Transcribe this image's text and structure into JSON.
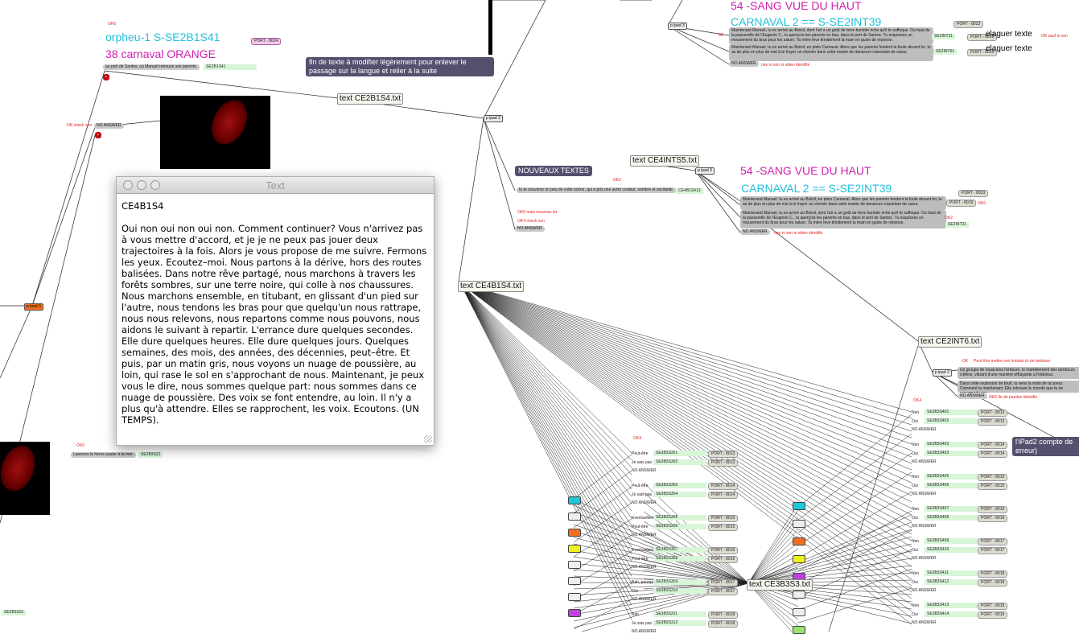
{
  "headings": {
    "orpheu": "orpheu-1  S-SE2B1S41",
    "carnaval_orange": "38 carnaval ORANGE",
    "sang1": "54 -SANG VUE DU HAUT",
    "carnaval2a": "CARNAVAL 2 == S-SE2INT39",
    "sang2": "54 -SANG VUE DU HAUT",
    "carnaval2b": "CARNAVAL 2 == S-SE2INT39"
  },
  "notes": {
    "fin_texte": "fin de texte à modifier légèrement pour enlever le passage sur la langue et relier à la suite",
    "nouveaux": "NOUVEAUX TEXTES",
    "ipad2_compte": "l'iPad2 compte de erreur)",
    "elaguer1": "elaguer texte",
    "elaguer2": "elaguer texte"
  },
  "objects": {
    "ce2b1s4": "text CE2B1S4.txt",
    "ce4ints5": "text CE4INTS5.txt",
    "ce4b1s4": "text CE4B1S4.txt",
    "ce2int6": "text CE2INT6.txt",
    "ce3b3s3": "text CE3B3S3.txt"
  },
  "window": {
    "title": "Text",
    "heading": "CE4B1S4",
    "body": "Oui non oui non oui non. Comment continuer? Vous n'arrivez pas à vous mettre d'accord, et je je ne peux pas jouer deux trajectoires à la fois. Alors je vous propose de me suivre. Fermons les yeux. Ecoutez–moi. Nous partons à la dérive, hors des routes balisées. Dans notre rêve partagé, nous marchons à travers les forêts sombres, sur une terre noire, qui colle à nos chaussures. Nous marchons ensemble, en titubant, en glissant d'un pied sur l'autre, nous tendons les bras pour que quelqu'un nous rattrape, nous nous relevons, nous repartons comme nous pouvons, nous aidons le suivant à repartir. L'errance dure quelques secondes. Elle dure quelques heures. Elle dure quelques jours. Quelques semaines, des mois, des années, des décennies, peut–être. Et puis, par un matin gris, nous voyons un nuage de poussière, au loin, qui rase le sol en s'approchant de nous. Maintenant, je peux vous le dire, nous sommes quelque part: nous sommes dans ce nuage de poussière. Des voix se font entendre, au loin. Il n'y a plus qu'à attendre. Elles se rapprochent, les voix. Ecoutons. (UN TEMPS)."
  },
  "small": {
    "ok6": "OK6",
    "port8024": "PORT - 8024",
    "port_santos": "au port de Santos, où Manuel retrouve ses parents.",
    "se2b1s41": "SE2B1S41",
    "ok_check": "OK check son",
    "no_answer": "NO ANSWER",
    "ipad": "p ipad 3",
    "ok": "OK",
    "ok_sauf": "OK sauf le son",
    "se2int31": "SE2INT31",
    "se2int61": "SE2INT61",
    "port8019": "PORT - 8019",
    "port8023": "PORT - 8023",
    "rien": "rien ni son ni video identifié",
    "ok2": "OK2",
    "ok6_nouveau": "OK6 mais nouveau txt",
    "ok4_check": "OK4 check son",
    "souviens": "tu te souviens un peu de cette scène, qui a pris une autre couleur, sombre et excitante.",
    "ce4b1s413": "CE4B1S413",
    "ok5": "OK5",
    "laissons": "Laissons le héros sauter à la mer.",
    "se2b3s21": "SE2B3S21",
    "se2b3s31": "SE2B3S31",
    "ok4": "OK4",
    "ok_peut": "Peut être mettre son lointain ici  de tambour",
    "ok_fin": "OK6 fin de paroles identifié",
    "groupe": "Un groupe de musiciens l'entoure, le martellement des tambours s'élève, vibrant d'une manière effrayante à l'intérieur.",
    "explosion": "Dans cette explosion de bruit, tu sens la main de ta soeur. Comment la maintenant. Elle retrouve le monde que tu ne comprends pas.",
    "manuel_long": "Maintenant Manuel, tu es arrivé au Brésil, en plein Carnaval. Alors que les parents fendent la foule devant toi, tu as de plus en plus de mal à te frayer un chemin dans cette marée de danseurs ruisselant de sueur.",
    "manuel_long2": "Maintenant Manuel, tu es arrivé au Brésil, dont l'air a un goût de terre humide riche qu'il te suffoque. Du haut de la passerelle de l'Eugenio C., tu aperçois tes parents en bas, dans le port de Santos. Tu esquisses un mouvement du bras pour les saluer. Ta mère lève timidement la main en guise de réponse."
  },
  "choices": {
    "right": [
      {
        "a": "Non",
        "ga": "SE3B3S401",
        "pa": "PORT - 8013",
        "b": "Oui",
        "gb": "SE3B3S402",
        "pb": "PORT - 8013"
      },
      {
        "a": "Non",
        "ga": "SE3B3S403",
        "pa": "PORT - 8014",
        "b": "Oui",
        "gb": "SE3B3S403",
        "pb": "PORT - 8014"
      },
      {
        "a": "Non",
        "ga": "SE3B3S405",
        "pa": "PORT - 8015",
        "b": "Oui",
        "gb": "SE3B3S406",
        "pb": "PORT - 8015"
      },
      {
        "a": "Non",
        "ga": "SE3B3S407",
        "pa": "PORT - 8016",
        "b": "Oui",
        "gb": "SE3B3S408",
        "pb": "PORT - 8016"
      },
      {
        "a": "Non",
        "ga": "SE3B3S409",
        "pa": "PORT - 8017",
        "b": "Oui",
        "gb": "SE3B3S410",
        "pb": "PORT - 8017"
      },
      {
        "a": "Non",
        "ga": "SE3B3S411",
        "pa": "PORT - 8018",
        "b": "Oui",
        "gb": "SE3B3S412",
        "pb": "PORT - 8018"
      },
      {
        "a": "Non",
        "ga": "SE3B3S413",
        "pa": "PORT - 8019",
        "b": "Oui",
        "gb": "SE3B3S414",
        "pb": "PORT - 8019"
      }
    ],
    "left": [
      {
        "a": "Peut-être",
        "ga": "SE3B3S301",
        "pa": "PORT - 8013",
        "b": "Je sais pas",
        "gb": "SE3B3S302",
        "pb": "PORT - 8013"
      },
      {
        "a": "Peut-être",
        "ga": "SE3B3S303",
        "pa": "PORT - 8014",
        "b": "Je sais pas",
        "gb": "SE3B3S304",
        "pb": "PORT - 8014"
      },
      {
        "a": "Eventuellement",
        "ga": "SE3B3S305",
        "pa": "PORT - 8015",
        "b": "Peut-être",
        "gb": "SE3B3S306",
        "pb": "PORT - 8015"
      },
      {
        "a": "Eventuellement",
        "ga": "SE3B3S307",
        "pa": "PORT - 8016",
        "b": "Peut-être",
        "gb": "SE3B3S308",
        "pb": "PORT - 8016"
      },
      {
        "a": "Bah, pourquoi pas",
        "ga": "SE3B3S309",
        "pa": "PORT - 8017",
        "b": "Oui",
        "gb": "SE3B3S310",
        "pb": "PORT - 8017"
      },
      {
        "a": "Bah",
        "ga": "SE3B3S311",
        "pa": "PORT - 8018",
        "b": "Je sais pas",
        "gb": "SE3B3S312",
        "pb": "PORT - 8018"
      }
    ]
  },
  "colors": {
    "cyan": "#20c0dc",
    "magenta": "#d020b0",
    "purple_note": "#55506e",
    "red_ok": "#e0201d"
  }
}
